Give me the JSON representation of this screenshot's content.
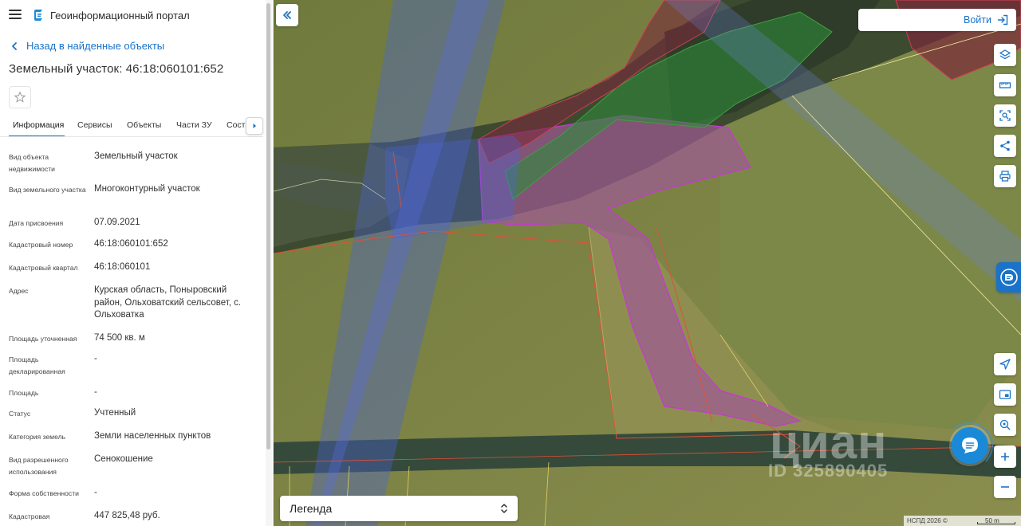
{
  "header": {
    "app_title": "Геоинформационный портал"
  },
  "nav": {
    "back_label": "Назад в найденные объекты"
  },
  "object": {
    "title": "Земельный участок: 46:18:060101:652"
  },
  "tabs": [
    {
      "label": "Информация",
      "active": true
    },
    {
      "label": "Сервисы",
      "active": false
    },
    {
      "label": "Объекты",
      "active": false
    },
    {
      "label": "Части ЗУ",
      "active": false
    },
    {
      "label": "Состав ЕЗП",
      "active": false
    }
  ],
  "properties": [
    {
      "label": "Вид объекта недвижимости",
      "value": "Земельный участок"
    },
    {
      "label": "Вид земельного участка",
      "value": "Многоконтурный участок"
    },
    {
      "label": "Дата присвоения",
      "value": "07.09.2021"
    },
    {
      "label": "Кадастровый номер",
      "value": "46:18:060101:652"
    },
    {
      "label": "Кадастровый квартал",
      "value": "46:18:060101"
    },
    {
      "label": "Адрес",
      "value": "Курская область, Поныровский район, Ольховатский сельсовет, с. Ольховатка"
    },
    {
      "label": "Площадь уточненная",
      "value": "74 500 кв. м"
    },
    {
      "label": "Площадь декларированная",
      "value": "-"
    },
    {
      "label": "Площадь",
      "value": "-"
    },
    {
      "label": "Статус",
      "value": "Учтенный"
    },
    {
      "label": "Категория земель",
      "value": "Земли населенных пунктов"
    },
    {
      "label": "Вид разрешенного использования",
      "value": "Сенокошение"
    },
    {
      "label": "Форма собственности",
      "value": "-"
    },
    {
      "label": "Кадастровая",
      "value": "447 825,48 руб."
    }
  ],
  "map": {
    "login_label": "Войти",
    "legend_label": "Легенда",
    "attribution": "НСПД 2026 ©",
    "scale_label": "50 m",
    "watermark_brand": "циан",
    "watermark_id": "ID 325890405",
    "colors": {
      "accent": "#1a73c8",
      "parcel_fill": "#b05a9e",
      "parcel_stroke": "#c43ad0",
      "overlay_blue": "#4a63d8",
      "boundary_red": "#e0503a"
    }
  },
  "icons": {
    "menu": "menu-icon",
    "logo": "portal-logo-icon",
    "back": "chevron-left-icon",
    "favorite": "star-icon",
    "tab_scroll": "chevron-right-icon",
    "collapse": "double-chevron-left-icon",
    "login": "login-icon",
    "layers": "layers-icon",
    "ruler": "ruler-icon",
    "select_area": "select-area-icon",
    "share": "share-icon",
    "print": "print-icon",
    "assistant": "assistant-icon",
    "locate": "locate-icon",
    "minimap": "minimap-icon",
    "geo_search": "geo-search-icon",
    "zoom_in": "plus-icon",
    "zoom_out": "minus-icon",
    "chat": "chat-icon",
    "legend_toggle": "up-down-arrows-icon"
  }
}
